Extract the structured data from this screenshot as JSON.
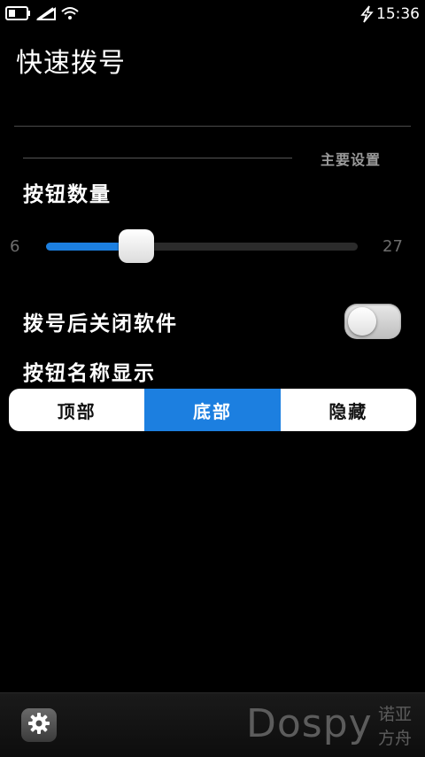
{
  "status_bar": {
    "time": "15:36"
  },
  "page": {
    "title": "快速拨号"
  },
  "section": {
    "label": "主要设置"
  },
  "button_count": {
    "label": "按钮数量",
    "min": "6",
    "max": "27",
    "value_fraction": 0.29
  },
  "close_after_dial": {
    "label": "拨号后关闭软件",
    "enabled": false
  },
  "button_name_display": {
    "label": "按钮名称显示",
    "options": [
      "顶部",
      "底部",
      "隐藏"
    ],
    "selected_index": 1
  },
  "watermark": {
    "brand": "Dospy",
    "cn_line1": "诺亚",
    "cn_line2": "方舟"
  },
  "colors": {
    "accent": "#1c7fe0",
    "background": "#000000"
  }
}
